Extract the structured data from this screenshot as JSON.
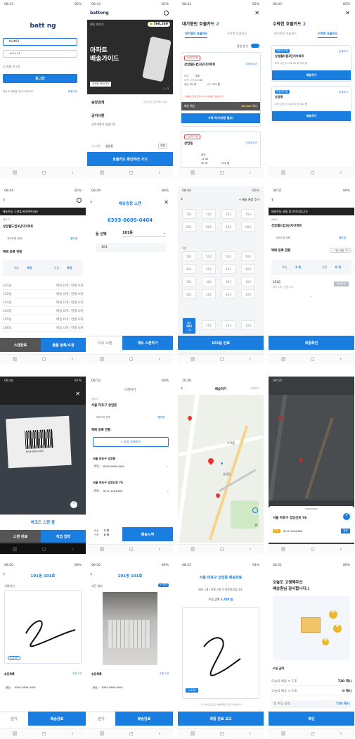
{
  "status": {
    "t1": "08:43",
    "t2": "08:43",
    "t3": "08:43",
    "t4": "08:43",
    "t5": "08:44",
    "t6": "08:49",
    "t7": "08:44",
    "t8": "08:51",
    "t9": "08:48",
    "t10": "08:52",
    "t11": "10:48",
    "t12": "08:50",
    "t13": "08:50",
    "t14": "08:53",
    "t15": "08:51",
    "b1": "85%",
    "b2": "85%",
    "b3": "85%",
    "b4": "85%",
    "b5": "85%",
    "b6": "88%",
    "b7": "85%",
    "b8": "89%",
    "b9": "87%",
    "b10": "90%",
    "b11": "",
    "b12": "",
    "b13": "89%",
    "b14": "91%",
    "b15": "89%"
  },
  "login": {
    "logo": "batt ng",
    "user": "test02",
    "pass": "••••••",
    "keep": "자동 로그인",
    "login_btn": "로그인",
    "help": "배송로 계정을 찾으시겠어요?",
    "signup": "회원가입"
  },
  "home": {
    "logo": "battong",
    "banner_sub": "배송 최신호",
    "points": "568,260",
    "banner_title1": "아파트",
    "banner_title2": "배송가이드",
    "banner_cta": "자세히 보러가기",
    "page": "1 / 3",
    "menu1": "송장검색",
    "menu1_hint": "송장번호 입력해주세요",
    "notice_title": "공지사항",
    "notice_body": "공지사항이 없습니다.",
    "region_label": "내 지역",
    "region_value": "상암동",
    "region_btn": "변경",
    "cta": "호출카드 확인하러 가기"
  },
  "wait": {
    "title": "대기중인 호출카드",
    "count": "2",
    "tab1": "대기중인 호출카드",
    "tab2": "수락한 호출카드",
    "alarm": "알림 받기",
    "c1_tag": "긴급대기중",
    "c1_name": "상암월드컵3단지아파트",
    "c1_more": "자세히보기",
    "c1_r1k": "배송",
    "c1_r1v": "정조",
    "c1_r2k": "도착 시간",
    "c1_r2v": "17:30",
    "c1_r3k": "물량",
    "c1_r3v": "50 개",
    "c1_r4k": "단가",
    "c1_r4v": "720 원",
    "c1_note": "* 배송은 당일 오후 6시 이내에만 가능합니다",
    "c1_fee_k": "배송 예상",
    "c1_fee": "36,000 캐시",
    "c1_btn": "수락 하기(차량 필요)",
    "c2_tag": "긴급대기중",
    "c2_name": "상암동",
    "c2_more": "자세히보기",
    "c2_r1v": "정조",
    "c2_r2v": "17:30",
    "c2_r3v": "50 개",
    "c2_r4v": "720 원"
  },
  "accepted": {
    "title": "수락한 호출카드",
    "count": "2",
    "tab1": "대기중인 호출카드",
    "tab2": "수락한 호출카드",
    "c1_tag": "배송대기중",
    "c1_name": "상암월드컵3단지아파트",
    "c1_more": "상세보기",
    "c1_r1": "도착 시간 17:30",
    "c1_r2": "50 개",
    "c1_r3": "720 원",
    "c1_btn": "배송하기",
    "c2_tag": "배송대기중",
    "c2_name": "상암동",
    "c2_more": "상세보기",
    "c2_r1": "도착 시간 17:30",
    "c2_r2": "50 개",
    "c2_r3": "720 원",
    "c2_btn": "배송하기"
  },
  "deliv": {
    "banner": "배송하실, 스캔을 완료해주세요!",
    "addr_label": "배송지",
    "addr": "상암월드컵3단지아파트",
    "call": "가이드와 연락",
    "help": "헬프콜",
    "reg": "택배 등록 현황",
    "k1": "배송",
    "v1": "0개",
    "k2": "반품",
    "v2": "0개",
    "rows": [
      "101동",
      "102동",
      "103동",
      "104동",
      "105동",
      "106동"
    ],
    "row_val": "배송 0개 / 반품 0개",
    "b1": "스캔완료",
    "b2": "물품 등록/수정"
  },
  "scan": {
    "title": "배송송장 스캔",
    "code": "6393-0609-0404",
    "dong_k": "동 선택",
    "dong_v": "101동",
    "ho_v": "101",
    "b1": "다시 스캔",
    "b2": "계속 스캔하기"
  },
  "grid": {
    "add": "+ 배송 물품 추가",
    "rows": [
      [
        "701",
        "702",
        "703",
        "704"
      ],
      [
        "601",
        "602",
        "603",
        "604"
      ],
      [
        "501",
        "502",
        "503",
        "504"
      ],
      [
        "401",
        "402",
        "403",
        "404"
      ],
      [
        "301",
        "302",
        "303",
        "304"
      ],
      [
        "201",
        "202",
        "203",
        "204"
      ],
      [
        "101",
        "102",
        "103",
        "104"
      ]
    ],
    "floor": "5층",
    "sel_label": "배송",
    "sel_count": "1개",
    "done": "101동 완료"
  },
  "regdone": {
    "banner": "배송하실, 배송 및 부탁드립니다!",
    "addr_label": "배송지",
    "addr": "상암월드컵3단지아파트",
    "call": "가이드와 연락",
    "help": "헬프콜",
    "reg": "택배 등록 현황",
    "add": "+ 배송 물품 추가",
    "k1": "배송",
    "v1": "1 개",
    "k2": "반품",
    "v2": "0 개",
    "row": "101동",
    "row_sub": "배송 1개 / 반품 0개",
    "row_btn": "배송완료",
    "btn": "최종확인"
  },
  "camera": {
    "title": "바코드 스캔 중",
    "b1": "스캔 완료",
    "b2": "직접 입력",
    "bar": "6393-0609-0404"
  },
  "delivering": {
    "hdr": "스캔하기",
    "addr_label": "배송지",
    "addr": "서울 마포구 상암동",
    "call": "가이드와 연락",
    "help": "헬프콜",
    "reg": "택배 등록 현황",
    "add": "+ 송장 등록하기",
    "i1_title": "서울 마포구 상암동",
    "i1_tag": "배송",
    "i1_code": "6393-0609-0404",
    "i2_title": "서울 마포구 상암산로 76",
    "i2_tag": "배송",
    "i2_code": "9917-1504-600",
    "f1": "배송",
    "f1v": "2 개",
    "f2": "반품",
    "f2v": "0 개",
    "btn": "배송시작"
  },
  "map": {
    "title": "배송하기",
    "skip": "전체보기",
    "label1": "수색동",
    "label2": "상암동",
    "sheet_addr": "서울 마포구 상암산로 76",
    "sheet_tag": "배송",
    "sheet_code": "9917-1504-600",
    "sheet_btn": "완료"
  },
  "sign": {
    "title": "101동 101호",
    "label": "서명하기",
    "clear": "CLEAR",
    "sec": "송장목록",
    "sec_r": "수량 1개",
    "tag": "배송",
    "code": "6393-0609-0404",
    "b1": "닫기",
    "b2": "배송완료"
  },
  "photo": {
    "title": "101동 101호",
    "label": "사진 첨부",
    "add": "+ 추가",
    "sec": "송장목록",
    "sec_r": "수량 1개",
    "tag": "배송",
    "code": "6393-0609-0404",
    "b1": "닫기",
    "b2": "배송완료"
  },
  "finish": {
    "title": "서울 마포구 상암동 배송완료",
    "sub": "배송 2개 / 반품 0개 가 완료되었습니다.",
    "earn_k": "수입 금액",
    "earn_v": "1,440 원",
    "clear": "CLEAR",
    "note": "* 위 서명으로 모든 배송물품을 전달 하였습니다",
    "btn": "최종 완료 보고"
  },
  "thanks": {
    "t1": "오늘도 고생해주신",
    "t2": "배송원님 감사합니다:)",
    "sec": "수입 금액",
    "r1": "오늘의 배송 ✕ 1개",
    "r1v": "720 캐시",
    "r2": "오늘의 배송 ✕ 0개",
    "r2v": "0 캐시",
    "tot_k": "총 수입 금액",
    "tot_v": "720 캐시",
    "btn": "확인"
  },
  "colors": {
    "primary": "#1a7de0",
    "danger": "#e44444",
    "dark": "#333333"
  }
}
